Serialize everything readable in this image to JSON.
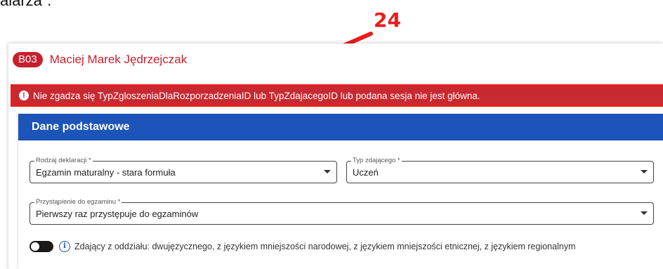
{
  "top_text": "alarza”.",
  "annotation": {
    "number": "24"
  },
  "person": {
    "badge": "B03",
    "name": "Maciej Marek Jędrzejczak"
  },
  "error": {
    "message": "Nie zgadza się TypZgloszeniaDlaRozporzadzeniaID lub TypZdajacegoID lub podana sesja nie jest główna."
  },
  "section": {
    "title": "Dane podstawowe",
    "fields": {
      "rodzaj": {
        "label": "Rodzaj deklaracji *",
        "value": "Egzamin maturalny - stara formuła"
      },
      "typ": {
        "label": "Typ zdającego *",
        "value": "Uczeń"
      },
      "przystapienie": {
        "label": "Przystąpienie do egzaminu *",
        "value": "Pierwszy raz przystępuje do egzaminów"
      }
    },
    "toggle": {
      "label": "Zdający z oddziału: dwujęzycznego, z językiem mniejszości narodowej, z językiem mniejszości etnicznej, z językiem regionalnym",
      "state": "off"
    }
  },
  "colors": {
    "brand_red": "#c8202f",
    "header_blue": "#1c54b9",
    "annotation_red": "#e81d1d"
  }
}
